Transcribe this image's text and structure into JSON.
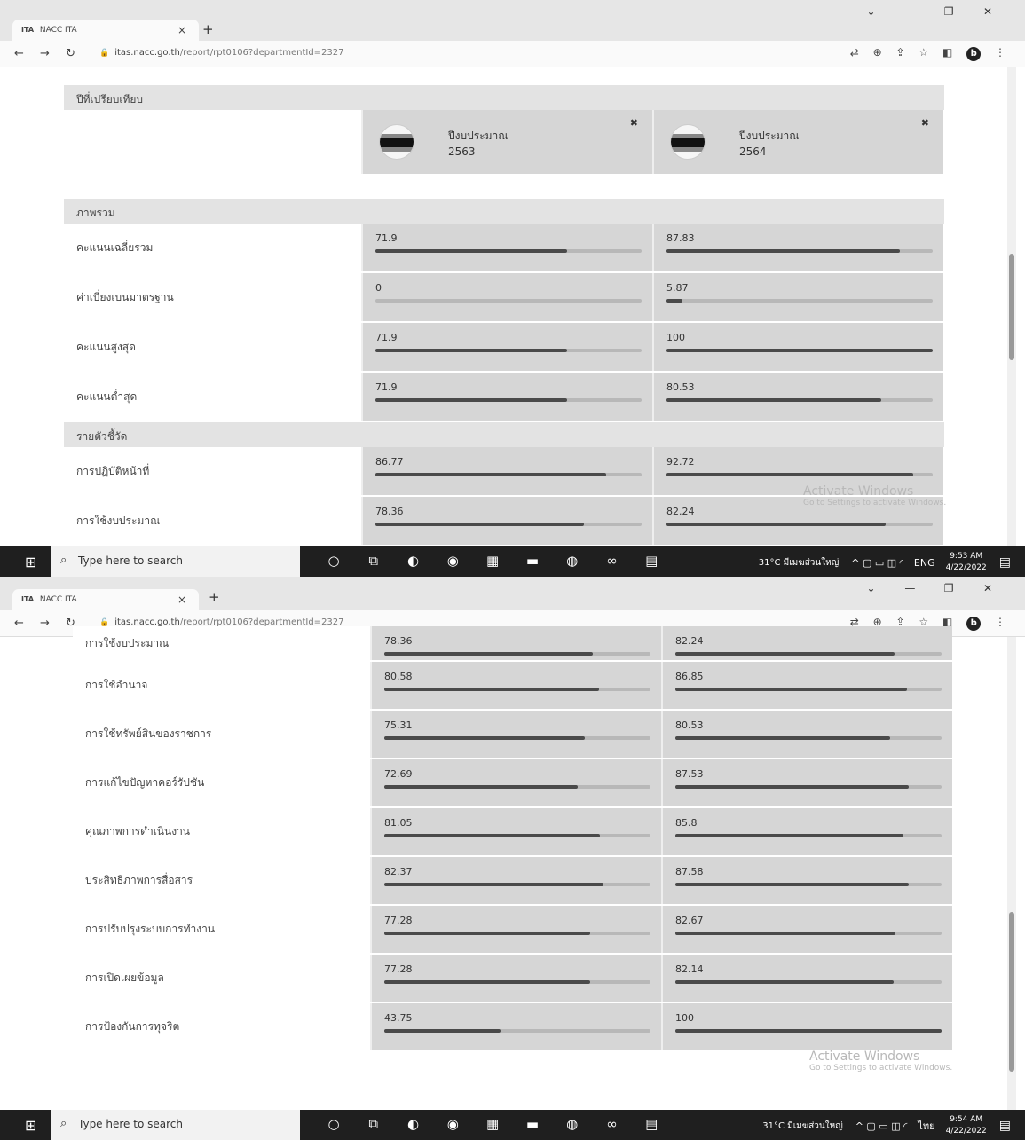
{
  "browser": {
    "tab_title": "NACC ITA",
    "favicon_text": "ITA",
    "url_host": "itas.nacc.go.th",
    "url_path": "/report/rpt0106?departmentId=2327"
  },
  "report": {
    "compare_label": "ปีที่เปรียบเทียบ",
    "columns": [
      {
        "label": "ปีงบประมาณ",
        "year": "2563"
      },
      {
        "label": "ปีงบประมาณ",
        "year": "2564"
      }
    ],
    "section_overview": "ภาพรวม",
    "section_indicators": "รายตัวชี้วัด"
  },
  "screen1": {
    "overview_rows": [
      {
        "label": "คะแนนเฉลี่ยรวม",
        "v1": "71.9",
        "p1": 71.9,
        "v2": "87.83",
        "p2": 87.83
      },
      {
        "label": "ค่าเบี่ยงเบนมาตรฐาน",
        "v1": "0",
        "p1": 0,
        "v2": "5.87",
        "p2": 5.87
      },
      {
        "label": "คะแนนสูงสุด",
        "v1": "71.9",
        "p1": 71.9,
        "v2": "100",
        "p2": 100
      },
      {
        "label": "คะแนนต่ำสุด",
        "v1": "71.9",
        "p1": 71.9,
        "v2": "80.53",
        "p2": 80.53
      }
    ],
    "indicator_rows": [
      {
        "label": "การปฏิบัติหน้าที่",
        "v1": "86.77",
        "p1": 86.77,
        "v2": "92.72",
        "p2": 92.72
      },
      {
        "label": "การใช้งบประมาณ",
        "v1": "78.36",
        "p1": 78.36,
        "v2": "82.24",
        "p2": 82.24
      }
    ],
    "time": "9:53 AM",
    "date": "4/22/2022",
    "lang": "ENG"
  },
  "screen2": {
    "partial_row": {
      "label": "การใช้งบประมาณ",
      "v1": "78.36",
      "p1": 78.36,
      "v2": "82.24",
      "p2": 82.24
    },
    "indicator_rows": [
      {
        "label": "การใช้อำนาจ",
        "v1": "80.58",
        "p1": 80.58,
        "v2": "86.85",
        "p2": 86.85
      },
      {
        "label": "การใช้ทรัพย์สินของราชการ",
        "v1": "75.31",
        "p1": 75.31,
        "v2": "80.53",
        "p2": 80.53
      },
      {
        "label": "การแก้ไขปัญหาคอร์รัปชัน",
        "v1": "72.69",
        "p1": 72.69,
        "v2": "87.53",
        "p2": 87.53
      },
      {
        "label": "คุณภาพการดำเนินงาน",
        "v1": "81.05",
        "p1": 81.05,
        "v2": "85.8",
        "p2": 85.8
      },
      {
        "label": "ประสิทธิภาพการสื่อสาร",
        "v1": "82.37",
        "p1": 82.37,
        "v2": "87.58",
        "p2": 87.58
      },
      {
        "label": "การปรับปรุงระบบการทำงาน",
        "v1": "77.28",
        "p1": 77.28,
        "v2": "82.67",
        "p2": 82.67
      },
      {
        "label": "การเปิดเผยข้อมูล",
        "v1": "77.28",
        "p1": 77.28,
        "v2": "82.14",
        "p2": 82.14
      },
      {
        "label": "การป้องกันการทุจริต",
        "v1": "43.75",
        "p1": 43.75,
        "v2": "100",
        "p2": 100
      }
    ],
    "time": "9:54 AM",
    "date": "4/22/2022",
    "lang": "ไทย"
  },
  "watermark": {
    "title": "Activate Windows",
    "subtitle": "Go to Settings to activate Windows."
  },
  "taskbar": {
    "search_placeholder": "Type here to search",
    "weather": "31°C มีเมฆส่วนใหญ่"
  }
}
